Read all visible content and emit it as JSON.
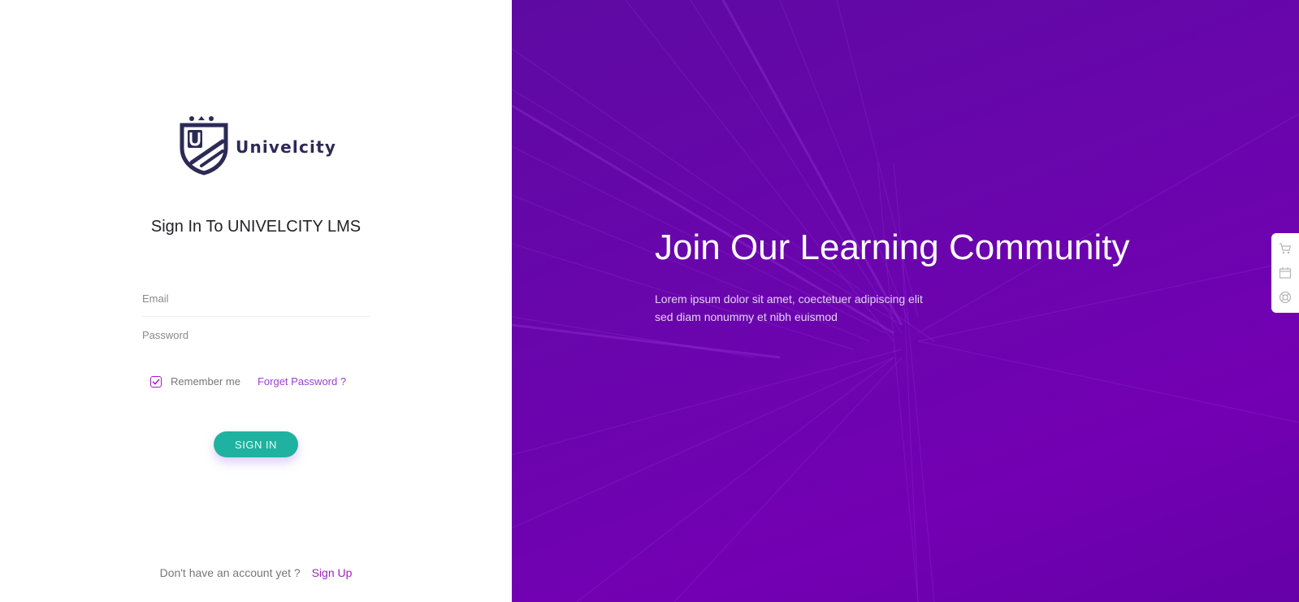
{
  "brand": {
    "name": "Univelcity",
    "logo_letter": "U",
    "color": "#2c2a55"
  },
  "form": {
    "title": "Sign In To UNIVELCITY LMS",
    "email_placeholder": "Email",
    "password_placeholder": "Password",
    "remember_label": "Remember me",
    "remember_checked": true,
    "forget_label": "Forget Password ?",
    "submit_label": "SIGN IN"
  },
  "signup": {
    "question": "Don't have an account yet ?",
    "link_label": "Sign Up"
  },
  "hero": {
    "title": "Join Our Learning Community",
    "text": "Lorem ipsum dolor sit amet, coectetuer adipiscing elit sed diam nonummy et nibh euismod"
  },
  "side_tools": [
    {
      "icon": "cart-icon"
    },
    {
      "icon": "calendar-icon"
    },
    {
      "icon": "lifebuoy-icon"
    }
  ],
  "colors": {
    "accent_purple": "#a01fc0",
    "button_teal": "#1fb2a0",
    "hero_bg": "#6a05ad"
  }
}
